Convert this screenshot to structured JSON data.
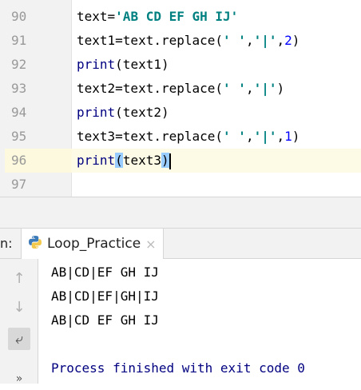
{
  "editor": {
    "lines": [
      {
        "num": "90",
        "parts": [
          {
            "t": "text=",
            "c": ""
          },
          {
            "t": "'AB CD EF GH IJ'",
            "c": "str"
          }
        ]
      },
      {
        "num": "91",
        "parts": [
          {
            "t": "text1=text.replace(",
            "c": ""
          },
          {
            "t": "' '",
            "c": "str"
          },
          {
            "t": ",",
            "c": ""
          },
          {
            "t": "'|'",
            "c": "str"
          },
          {
            "t": ",",
            "c": ""
          },
          {
            "t": "2",
            "c": "num"
          },
          {
            "t": ")",
            "c": ""
          }
        ]
      },
      {
        "num": "92",
        "parts": [
          {
            "t": "print",
            "c": "kw"
          },
          {
            "t": "(text1)",
            "c": ""
          }
        ]
      },
      {
        "num": "93",
        "parts": [
          {
            "t": "text2=text.replace(",
            "c": ""
          },
          {
            "t": "' '",
            "c": "str"
          },
          {
            "t": ",",
            "c": ""
          },
          {
            "t": "'|'",
            "c": "str"
          },
          {
            "t": ")",
            "c": ""
          }
        ]
      },
      {
        "num": "94",
        "parts": [
          {
            "t": "print",
            "c": "kw"
          },
          {
            "t": "(text2)",
            "c": ""
          }
        ]
      },
      {
        "num": "95",
        "parts": [
          {
            "t": "text3=text.replace(",
            "c": ""
          },
          {
            "t": "' '",
            "c": "str"
          },
          {
            "t": ",",
            "c": ""
          },
          {
            "t": "'|'",
            "c": "str"
          },
          {
            "t": ",",
            "c": ""
          },
          {
            "t": "1",
            "c": "num"
          },
          {
            "t": ")",
            "c": ""
          }
        ]
      },
      {
        "num": "96",
        "parts": [
          {
            "t": "print",
            "c": "kw"
          },
          {
            "t": "(",
            "c": "paren-hl"
          },
          {
            "t": "text3",
            "c": ""
          },
          {
            "t": ")",
            "c": "paren-hl"
          }
        ]
      },
      {
        "num": "97",
        "parts": []
      }
    ],
    "current_line": "96"
  },
  "run": {
    "prefix": "n:",
    "tab_label": "Loop_Practice",
    "tab_close": "×",
    "tab_icon": "python-icon"
  },
  "toolbar": {
    "buttons": [
      {
        "name": "scroll-up-icon",
        "glyph": "↑"
      },
      {
        "name": "scroll-down-icon",
        "glyph": "↓"
      },
      {
        "name": "soft-wrap-icon",
        "glyph": "⤶"
      },
      {
        "name": "more-icon",
        "glyph": "»"
      }
    ]
  },
  "console": {
    "output": [
      "AB|CD|EF GH IJ",
      "AB|CD|EF|GH|IJ",
      "AB|CD EF GH IJ"
    ],
    "exit_message": "Process finished with exit code 0"
  },
  "colors": {
    "keyword": "#000080",
    "string": "#008080",
    "number": "#0000ff",
    "paren_match": "#99ccff",
    "current_line": "#fdfbe6"
  }
}
